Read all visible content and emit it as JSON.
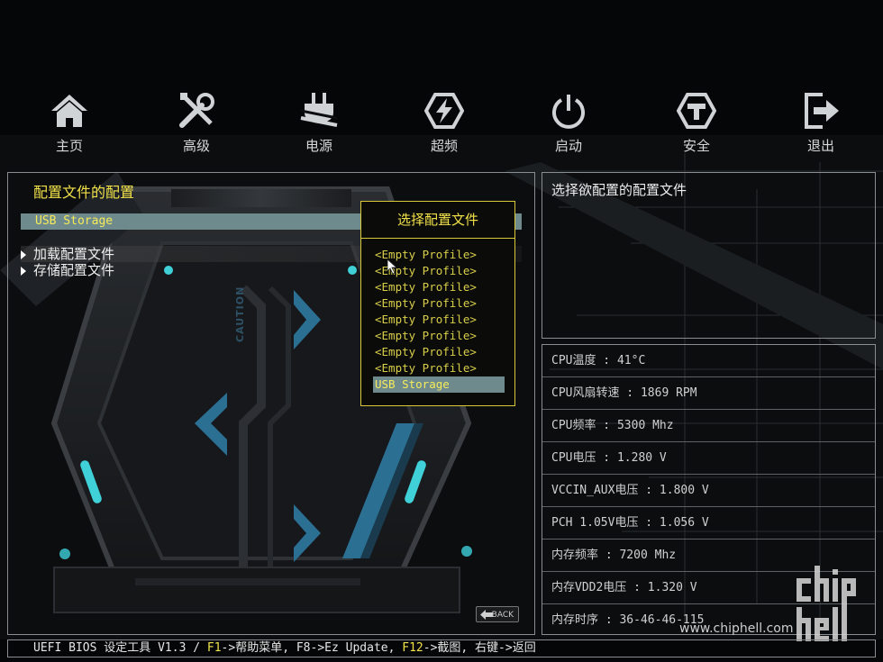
{
  "nav": [
    {
      "label": "主页",
      "icon": "home-icon"
    },
    {
      "label": "高级",
      "icon": "tools-icon"
    },
    {
      "label": "电源",
      "icon": "power-plug-icon"
    },
    {
      "label": "超频",
      "icon": "overclock-lightning-icon"
    },
    {
      "label": "启动",
      "icon": "power-button-icon"
    },
    {
      "label": "安全",
      "icon": "shield-lock-icon"
    },
    {
      "label": "退出",
      "icon": "exit-icon"
    }
  ],
  "left_panel": {
    "title": "配置文件的配置",
    "storage_value": "USB Storage",
    "items": [
      {
        "label": "加载配置文件"
      },
      {
        "label": "存储配置文件"
      }
    ]
  },
  "popup": {
    "title": "选择配置文件",
    "items": [
      "<Empty Profile>",
      "<Empty Profile>",
      "<Empty Profile>",
      "<Empty Profile>",
      "<Empty Profile>",
      "<Empty Profile>",
      "<Empty Profile>",
      "<Empty Profile>",
      "USB Storage"
    ],
    "selected_index": 8
  },
  "help": {
    "text": "选择欲配置的配置文件"
  },
  "status": [
    "CPU温度 : 41°C",
    "CPU风扇转速 : 1869 RPM",
    "CPU频率 : 5300 Mhz",
    "CPU电压 : 1.280 V",
    "VCCIN_AUX电压 : 1.800 V",
    "PCH 1.05V电压 : 1.056 V",
    "内存频率 : 7200 Mhz",
    "内存VDD2电压 : 1.320 V",
    "内存时序 : 36-46-46-115"
  ],
  "back_label": "BACK",
  "caution_text": "CAUTION",
  "bottom_bar": {
    "prefix": "UEFI BIOS 设定工具 V1.3 / ",
    "f1": "F1",
    "f1_text": "->帮助菜单, F8->Ez Update, ",
    "f12": "F12",
    "f12_text": "->截图, 右键->返回"
  },
  "watermark": {
    "url": "www.chiphell.com",
    "logo_text": "chip hell"
  },
  "colors": {
    "accent_yellow": "#f2e24a",
    "highlight_teal": "#6e8a8c",
    "panel_border": "#8a8d90",
    "glow_cyan": "#3fd0d8"
  }
}
